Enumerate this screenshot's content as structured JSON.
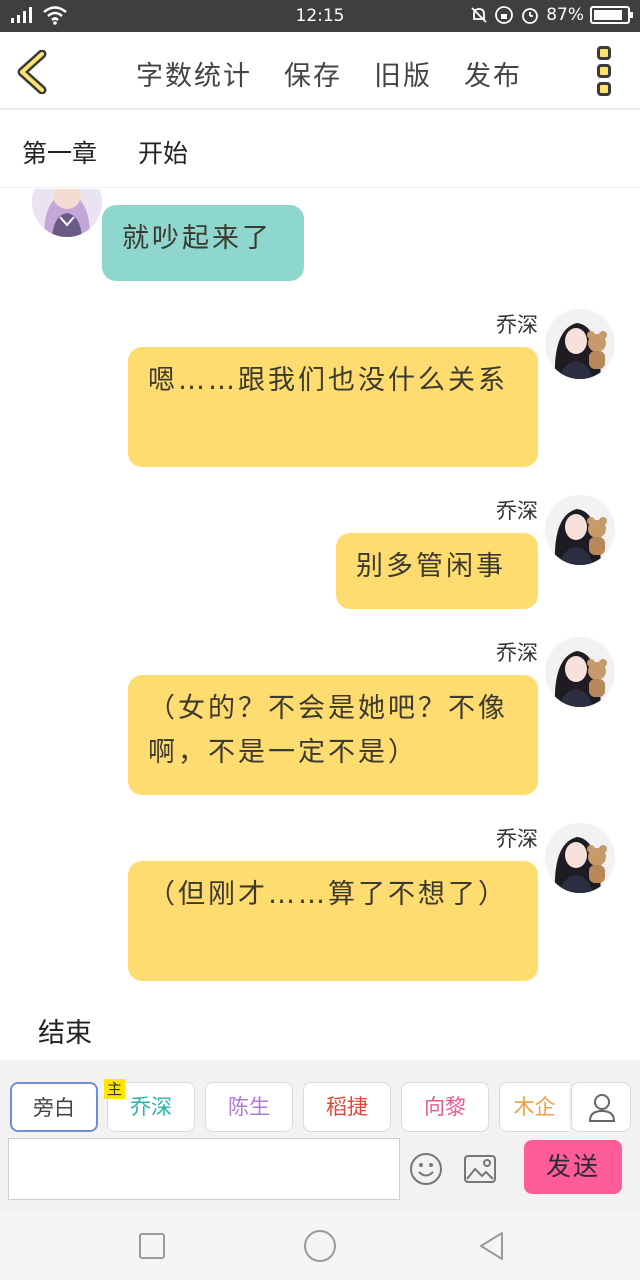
{
  "status_bar": {
    "time": "12:15",
    "battery_text": "87%",
    "battery_level": 0.87
  },
  "top_nav": {
    "items": [
      "字数统计",
      "保存",
      "旧版",
      "发布"
    ]
  },
  "chapter": {
    "number": "第一章",
    "title": "开始"
  },
  "messages": [
    {
      "side": "left",
      "sender": "",
      "text": "就吵起来了",
      "color": "#8ed7cf"
    },
    {
      "side": "right",
      "sender": "乔深",
      "text": "嗯……跟我们也没什么关系",
      "color": "#ffdc6f"
    },
    {
      "side": "right",
      "sender": "乔深",
      "text": "别多管闲事",
      "color": "#ffdc6f"
    },
    {
      "side": "right",
      "sender": "乔深",
      "text": "（女的？不会是她吧？不像啊，不是一定不是）",
      "color": "#ffdc6f"
    },
    {
      "side": "right",
      "sender": "乔深",
      "text": "（但刚才……算了不想了）",
      "color": "#ffdc6f"
    }
  ],
  "end_label": "结束",
  "characters": [
    {
      "name": "旁白",
      "color": "#444444"
    },
    {
      "name": "乔深",
      "color": "#29b3a7",
      "badge": "主"
    },
    {
      "name": "陈生",
      "color": "#b27ad6"
    },
    {
      "name": "稻捷",
      "color": "#e0463a"
    },
    {
      "name": "向黎",
      "color": "#e65c8e"
    },
    {
      "name": "木企",
      "color": "#f0a040"
    }
  ],
  "input": {
    "value": "",
    "placeholder": ""
  },
  "send_label": "发送",
  "icons": {
    "back": "chevron-left-icon",
    "more": "three-dots-vertical-icon",
    "person": "person-icon",
    "emoji": "smiley-icon",
    "image": "image-icon"
  }
}
